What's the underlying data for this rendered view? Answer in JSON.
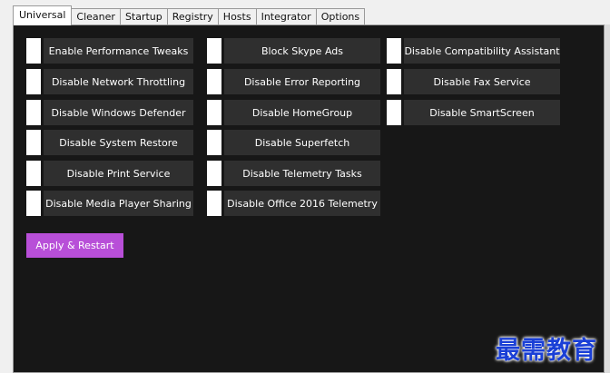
{
  "tabs": [
    {
      "label": "Universal",
      "active": true
    },
    {
      "label": "Cleaner",
      "active": false
    },
    {
      "label": "Startup",
      "active": false
    },
    {
      "label": "Registry",
      "active": false
    },
    {
      "label": "Hosts",
      "active": false
    },
    {
      "label": "Integrator",
      "active": false
    },
    {
      "label": "Options",
      "active": false
    }
  ],
  "options": {
    "col1": [
      "Enable Performance Tweaks",
      "Disable Network Throttling",
      "Disable Windows Defender",
      "Disable System Restore",
      "Disable Print Service",
      "Disable Media Player Sharing"
    ],
    "col2": [
      "Block Skype Ads",
      "Disable Error Reporting",
      "Disable HomeGroup",
      "Disable Superfetch",
      "Disable Telemetry Tasks",
      "Disable Office 2016 Telemetry"
    ],
    "col3": [
      "Disable Compatibility Assistant",
      "Disable Fax Service",
      "Disable SmartScreen"
    ]
  },
  "apply_button": "Apply & Restart",
  "watermark": "最需教育",
  "colors": {
    "panel_bg": "#171717",
    "option_bg": "#2f2f2f",
    "apply_bg": "#b84fd8",
    "watermark": "#1a3fd6"
  }
}
